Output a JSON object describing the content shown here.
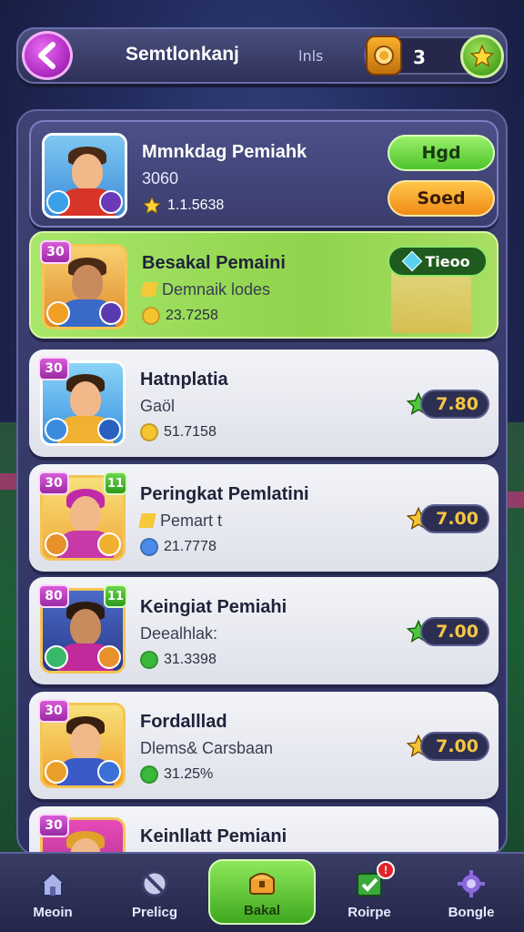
{
  "header": {
    "title": "Semtlonkanj",
    "subtitle": "lnls",
    "currency_value": "3"
  },
  "players": [
    {
      "name": "Mmnkdag Pemiahk",
      "sub": "3060",
      "stat": "1.1.5638",
      "primary_button": "Hgd",
      "secondary_button": "Soed"
    },
    {
      "rank": "30",
      "name": "Besakal Pemaini",
      "sub": "Demnaik lodes",
      "stat": "23.7258",
      "tag": "Tieoo"
    },
    {
      "rank": "30",
      "name": "Hatnplatia",
      "sub": "Gaöl",
      "stat": "51.7158",
      "price": "7.80"
    },
    {
      "rank": "30",
      "level": "11",
      "name": "Peringkat Pemlatini",
      "sub": "Pemart t",
      "stat": "21.7778",
      "price": "7.00"
    },
    {
      "rank": "80",
      "level": "11",
      "name": "Keingiat Pemiahi",
      "sub": "Deealhlak:",
      "stat": "31.3398",
      "price": "7.00"
    },
    {
      "rank": "30",
      "name": "Fordalllad",
      "sub": "Dlems& Carsbaan",
      "stat": "31.25%",
      "price": "7.00"
    },
    {
      "rank": "30",
      "name": "Keinllatt Pemiani"
    }
  ],
  "nav": [
    {
      "label": "Meoin",
      "icon": "home-icon"
    },
    {
      "label": "Prelicg",
      "icon": "block-icon"
    },
    {
      "label": "Bakal",
      "icon": "chest-icon"
    },
    {
      "label": "Roirpe",
      "icon": "checklist-icon",
      "badge": "!"
    },
    {
      "label": "Bongle",
      "icon": "gear-icon"
    }
  ],
  "colors": {
    "accent_green": "#4fc42c",
    "accent_orange": "#f08a16",
    "accent_purple": "#b32fc6",
    "price_gold": "#f6c642"
  }
}
